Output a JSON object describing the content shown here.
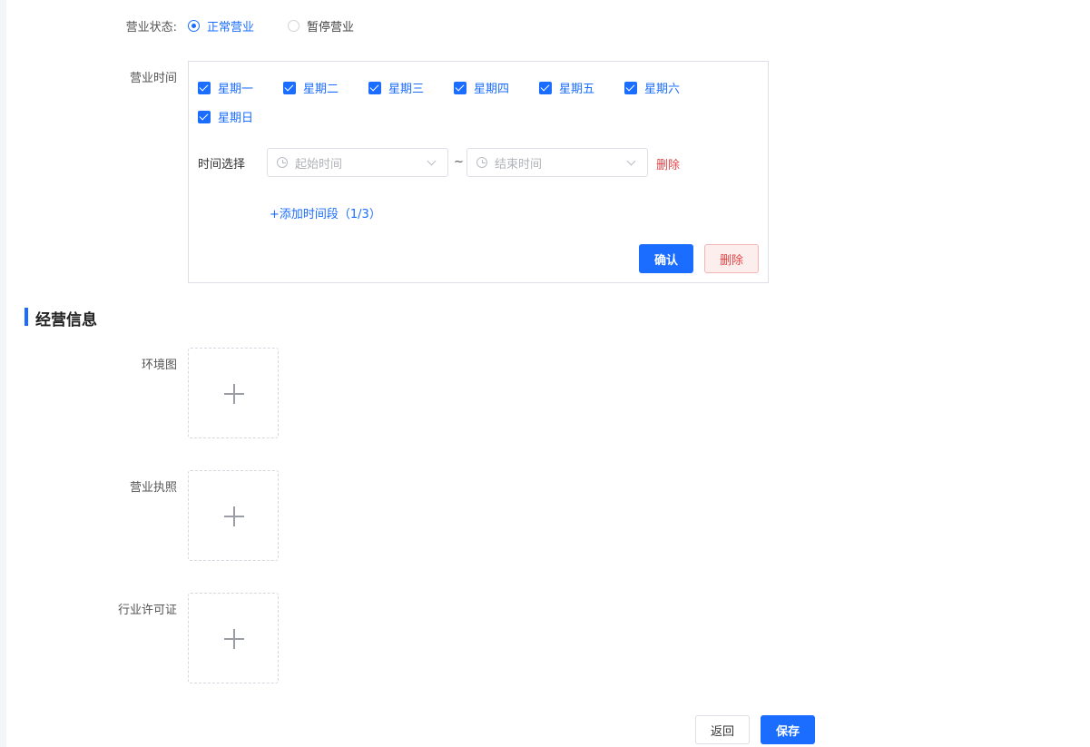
{
  "status": {
    "label": "营业状态:",
    "options": [
      {
        "label": "正常营业",
        "checked": true
      },
      {
        "label": "暂停营业",
        "checked": false
      }
    ]
  },
  "hours": {
    "label": "营业时间",
    "days": [
      "星期一",
      "星期二",
      "星期三",
      "星期四",
      "星期五",
      "星期六",
      "星期日"
    ],
    "time_label": "时间选择",
    "start_placeholder": "起始时间",
    "end_placeholder": "结束时间",
    "separator": "~",
    "remove_link": "删除",
    "add_link": "+添加时间段（1/3）",
    "confirm_button": "确认",
    "delete_button": "删除"
  },
  "business": {
    "section_title": "经营信息",
    "uploads": [
      {
        "label": "环境图"
      },
      {
        "label": "营业执照"
      },
      {
        "label": "行业许可证"
      }
    ]
  },
  "footer": {
    "back_button": "返回",
    "save_button": "保存"
  },
  "colors": {
    "accent": "#1a6dff",
    "danger": "#e54545"
  }
}
